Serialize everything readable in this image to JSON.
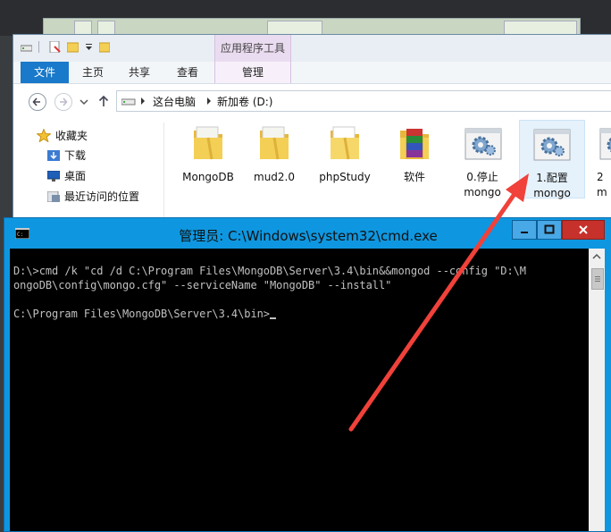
{
  "explorer": {
    "ribbon": {
      "context_group_label": "应用程序工具",
      "tabs": [
        "文件",
        "主页",
        "共享",
        "查看",
        "管理"
      ]
    },
    "address": {
      "crumbs": [
        "这台电脑",
        "新加卷 (D:)"
      ]
    },
    "nav_pane": {
      "favorites_label": "收藏夹",
      "items": [
        "下载",
        "桌面",
        "最近访问的位置"
      ]
    },
    "files": [
      {
        "line1": "MongoDB",
        "line2": ""
      },
      {
        "line1": "mud2.0",
        "line2": ""
      },
      {
        "line1": "phpStudy",
        "line2": ""
      },
      {
        "line1": "软件",
        "line2": ""
      },
      {
        "line1": "0.停止",
        "line2": "mongo"
      },
      {
        "line1": "1.配置",
        "line2": "mongo"
      },
      {
        "line1": "2",
        "line2": "m"
      }
    ],
    "colors": {
      "file_tab": "#1979ca",
      "context_tab": "#eadcf0"
    }
  },
  "cmd": {
    "title": "管理员: C:\\Windows\\system32\\cmd.exe",
    "lines": [
      "D:\\>cmd /k \"cd /d C:\\Program Files\\MongoDB\\Server\\3.4\\bin&&mongod --config \"D:\\M",
      "ongoDB\\config\\mongo.cfg\" --serviceName \"MongoDB\" --install\"",
      "",
      "C:\\Program Files\\MongoDB\\Server\\3.4\\bin>"
    ],
    "colors": {
      "titlebar": "#0e97e0",
      "close_button": "#c7312b",
      "text": "#c0c0c0"
    }
  },
  "annotation": {
    "arrow_color": "#f0413a"
  }
}
